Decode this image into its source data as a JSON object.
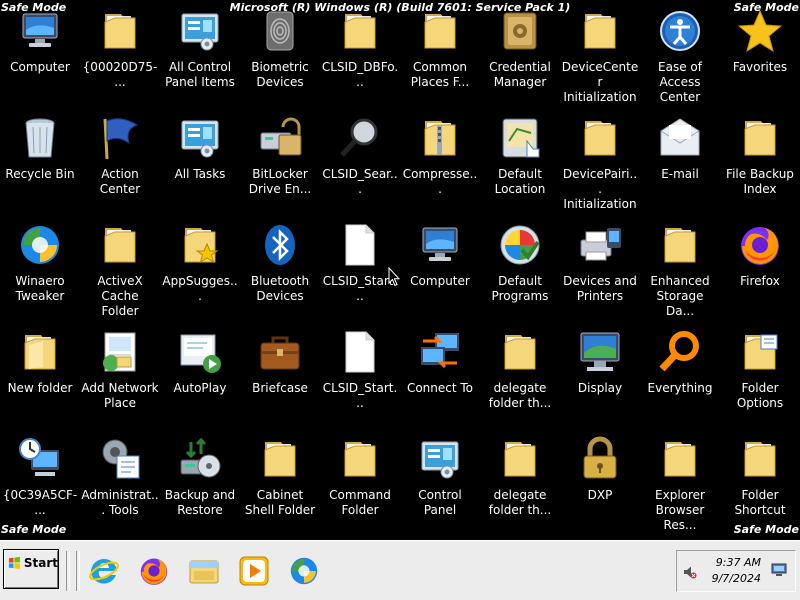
{
  "window": {
    "title": "Microsoft (R) Windows (R) (Build 7601: Service Pack 1)",
    "safe_mode_label": "Safe Mode"
  },
  "icons": [
    {
      "label": "Computer",
      "icon": "computer-icon"
    },
    {
      "label": "{00020D75-...",
      "icon": "folder-icon"
    },
    {
      "label": "All Control Panel Items",
      "icon": "control-panel-icon"
    },
    {
      "label": "Biometric Devices",
      "icon": "fingerprint-icon"
    },
    {
      "label": "CLSID_DBFo...",
      "icon": "folder-icon"
    },
    {
      "label": "Common Places F...",
      "icon": "folder-icon"
    },
    {
      "label": "Credential Manager",
      "icon": "vault-icon"
    },
    {
      "label": "DeviceCenter Initialization",
      "icon": "folder-icon"
    },
    {
      "label": "Ease of Access Center",
      "icon": "ease-of-access-icon"
    },
    {
      "label": "Favorites",
      "icon": "star-icon"
    },
    {
      "label": "Recycle Bin",
      "icon": "recycle-bin-icon"
    },
    {
      "label": "Action Center",
      "icon": "flag-icon"
    },
    {
      "label": "All Tasks",
      "icon": "control-panel-icon"
    },
    {
      "label": "BitLocker Drive En...",
      "icon": "bitlocker-icon"
    },
    {
      "label": "CLSID_Sear...",
      "icon": "magnifier-icon"
    },
    {
      "label": "Compresse...",
      "icon": "zip-folder-icon"
    },
    {
      "label": "Default Location",
      "icon": "location-icon"
    },
    {
      "label": "DevicePairi... Initialization",
      "icon": "folder-icon"
    },
    {
      "label": "E-mail",
      "icon": "envelope-icon"
    },
    {
      "label": "File Backup Index",
      "icon": "folder-icon"
    },
    {
      "label": "Winaero Tweaker",
      "icon": "winaero-icon"
    },
    {
      "label": "ActiveX Cache Folder",
      "icon": "folder-icon"
    },
    {
      "label": "AppSugges...",
      "icon": "folder-star-icon"
    },
    {
      "label": "Bluetooth Devices",
      "icon": "bluetooth-icon"
    },
    {
      "label": "CLSID_Start...",
      "icon": "blank-document-icon"
    },
    {
      "label": "Computer",
      "icon": "computer-icon"
    },
    {
      "label": "Default Programs",
      "icon": "default-programs-icon"
    },
    {
      "label": "Devices and Printers",
      "icon": "printer-icon"
    },
    {
      "label": "Enhanced Storage Da...",
      "icon": "folder-icon"
    },
    {
      "label": "Firefox",
      "icon": "firefox-icon"
    },
    {
      "label": "New folder",
      "icon": "folder-open-icon"
    },
    {
      "label": "Add Network Place",
      "icon": "network-place-icon"
    },
    {
      "label": "AutoPlay",
      "icon": "autoplay-icon"
    },
    {
      "label": "Briefcase",
      "icon": "briefcase-icon"
    },
    {
      "label": "CLSID_Start...",
      "icon": "blank-document-icon"
    },
    {
      "label": "Connect To",
      "icon": "connect-to-icon"
    },
    {
      "label": "delegate folder th...",
      "icon": "folder-icon"
    },
    {
      "label": "Display",
      "icon": "display-icon"
    },
    {
      "label": "Everything",
      "icon": "everything-icon"
    },
    {
      "label": "Folder Options",
      "icon": "folder-options-icon"
    },
    {
      "label": "{0C39A5CF-...",
      "icon": "clock-computer-icon"
    },
    {
      "label": "Administrat... Tools",
      "icon": "admin-tools-icon"
    },
    {
      "label": "Backup and Restore",
      "icon": "backup-icon"
    },
    {
      "label": "Cabinet Shell Folder",
      "icon": "folder-icon"
    },
    {
      "label": "Command Folder",
      "icon": "folder-icon"
    },
    {
      "label": "Control Panel",
      "icon": "control-panel-icon"
    },
    {
      "label": "delegate folder th...",
      "icon": "folder-icon"
    },
    {
      "label": "DXP",
      "icon": "padlock-icon"
    },
    {
      "label": "Explorer Browser Res...",
      "icon": "folder-icon"
    },
    {
      "label": "Folder Shortcut",
      "icon": "folder-icon"
    }
  ],
  "taskbar": {
    "start_label": "Start",
    "apps": [
      "internet-explorer-icon",
      "firefox-icon",
      "file-explorer-icon",
      "media-player-icon",
      "winaero-icon"
    ],
    "time": "9:37 AM",
    "date": "9/7/2024"
  },
  "colors": {
    "desktop_bg": "#000000",
    "folder_yellow": "#f3d77a",
    "taskbar_bg": "#ececec"
  }
}
